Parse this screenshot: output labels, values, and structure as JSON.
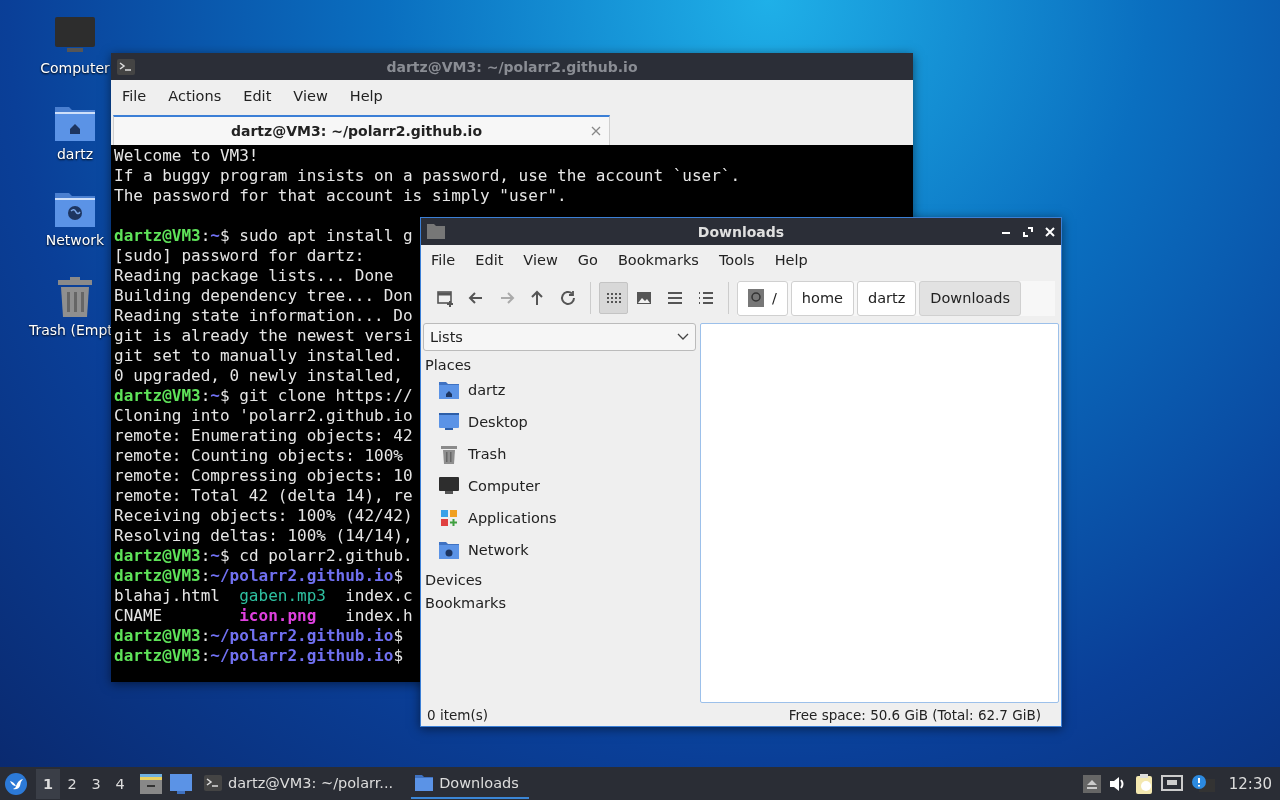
{
  "desktop_icons": [
    {
      "label": "Computer",
      "kind": "computer"
    },
    {
      "label": "dartz",
      "kind": "home"
    },
    {
      "label": "Network",
      "kind": "network"
    },
    {
      "label": "Trash (Empt",
      "kind": "trash"
    }
  ],
  "terminal": {
    "title": "dartz@VM3: ~/polarr2.github.io",
    "menu": [
      "File",
      "Actions",
      "Edit",
      "View",
      "Help"
    ],
    "tab": "dartz@VM3: ~/polarr2.github.io",
    "lines": [
      {
        "kind": "text",
        "segments": [
          {
            "text": "Welcome to VM3!",
            "kind": "plain"
          }
        ]
      },
      {
        "kind": "text",
        "segments": [
          {
            "text": "If a buggy program insists on a password, use the account `user`.",
            "kind": "plain"
          }
        ]
      },
      {
        "kind": "text",
        "segments": [
          {
            "text": "The password for that account is simply \"user\".",
            "kind": "plain"
          }
        ]
      },
      {
        "kind": "blank"
      },
      {
        "kind": "text",
        "segments": [
          {
            "text": "dartz@VM3",
            "kind": "user"
          },
          {
            "text": ":",
            "kind": "plain"
          },
          {
            "text": "~",
            "kind": "path"
          },
          {
            "text": "$ sudo apt install g",
            "kind": "plain"
          }
        ]
      },
      {
        "kind": "text",
        "segments": [
          {
            "text": "[sudo] password for dartz:",
            "kind": "plain"
          }
        ]
      },
      {
        "kind": "text",
        "segments": [
          {
            "text": "Reading package lists... Done",
            "kind": "plain"
          }
        ]
      },
      {
        "kind": "text",
        "segments": [
          {
            "text": "Building dependency tree... Don",
            "kind": "plain"
          }
        ]
      },
      {
        "kind": "text",
        "segments": [
          {
            "text": "Reading state information... Do",
            "kind": "plain"
          }
        ]
      },
      {
        "kind": "text",
        "segments": [
          {
            "text": "git is already the newest versi",
            "kind": "plain"
          }
        ]
      },
      {
        "kind": "text",
        "segments": [
          {
            "text": "git set to manually installed.",
            "kind": "plain"
          }
        ]
      },
      {
        "kind": "text",
        "segments": [
          {
            "text": "0 upgraded, 0 newly installed,",
            "kind": "plain"
          }
        ]
      },
      {
        "kind": "text",
        "segments": [
          {
            "text": "dartz@VM3",
            "kind": "user"
          },
          {
            "text": ":",
            "kind": "plain"
          },
          {
            "text": "~",
            "kind": "path"
          },
          {
            "text": "$ git clone https://",
            "kind": "plain"
          }
        ]
      },
      {
        "kind": "text",
        "segments": [
          {
            "text": "Cloning into 'polarr2.github.io",
            "kind": "plain"
          }
        ]
      },
      {
        "kind": "text",
        "segments": [
          {
            "text": "remote: Enumerating objects: 42",
            "kind": "plain"
          }
        ]
      },
      {
        "kind": "text",
        "segments": [
          {
            "text": "remote: Counting objects: 100%",
            "kind": "plain"
          }
        ]
      },
      {
        "kind": "text",
        "segments": [
          {
            "text": "remote: Compressing objects: 10",
            "kind": "plain"
          }
        ]
      },
      {
        "kind": "text",
        "segments": [
          {
            "text": "remote: Total 42 (delta 14), re",
            "kind": "plain"
          }
        ]
      },
      {
        "kind": "text",
        "segments": [
          {
            "text": "Receiving objects: 100% (42/42)",
            "kind": "plain"
          }
        ]
      },
      {
        "kind": "text",
        "segments": [
          {
            "text": "Resolving deltas: 100% (14/14),",
            "kind": "plain"
          }
        ]
      },
      {
        "kind": "text",
        "segments": [
          {
            "text": "dartz@VM3",
            "kind": "user"
          },
          {
            "text": ":",
            "kind": "plain"
          },
          {
            "text": "~",
            "kind": "path"
          },
          {
            "text": "$ cd polarr2.github.",
            "kind": "plain"
          }
        ]
      },
      {
        "kind": "text",
        "segments": [
          {
            "text": "dartz@VM3",
            "kind": "user"
          },
          {
            "text": ":",
            "kind": "plain"
          },
          {
            "text": "~/polarr2.github.io",
            "kind": "path"
          },
          {
            "text": "$",
            "kind": "plain"
          }
        ]
      },
      {
        "kind": "text",
        "segments": [
          {
            "text": "blahaj.html  ",
            "kind": "plain"
          },
          {
            "text": "gaben.mp3",
            "kind": "audio"
          },
          {
            "text": "  index.c",
            "kind": "plain"
          }
        ]
      },
      {
        "kind": "text",
        "segments": [
          {
            "text": "CNAME        ",
            "kind": "plain"
          },
          {
            "text": "icon.png",
            "kind": "image"
          },
          {
            "text": "   index.h",
            "kind": "plain"
          }
        ]
      },
      {
        "kind": "text",
        "segments": [
          {
            "text": "dartz@VM3",
            "kind": "user"
          },
          {
            "text": ":",
            "kind": "plain"
          },
          {
            "text": "~/polarr2.github.io",
            "kind": "path"
          },
          {
            "text": "$",
            "kind": "plain"
          }
        ]
      },
      {
        "kind": "text",
        "segments": [
          {
            "text": "dartz@VM3",
            "kind": "user"
          },
          {
            "text": ":",
            "kind": "plain"
          },
          {
            "text": "~/polarr2.github.io",
            "kind": "path"
          },
          {
            "text": "$",
            "kind": "plain"
          }
        ]
      }
    ]
  },
  "file_manager": {
    "title": "Downloads",
    "menu": [
      "File",
      "Edit",
      "View",
      "Go",
      "Bookmarks",
      "Tools",
      "Help"
    ],
    "nav_buttons": [
      {
        "kind": "new-tab",
        "disabled": false
      },
      {
        "kind": "back",
        "disabled": false
      },
      {
        "kind": "forward",
        "disabled": true
      },
      {
        "kind": "up",
        "disabled": false
      },
      {
        "kind": "reload",
        "disabled": false
      }
    ],
    "view_modes": [
      {
        "kind": "icons",
        "selected": true
      },
      {
        "kind": "thumbnails",
        "selected": false
      },
      {
        "kind": "compact",
        "selected": false
      },
      {
        "kind": "detailed",
        "selected": false
      }
    ],
    "path": [
      {
        "label": "/",
        "kind": "root",
        "selected": false
      },
      {
        "label": "home",
        "kind": "folder",
        "selected": false
      },
      {
        "label": "dartz",
        "kind": "folder",
        "selected": false
      },
      {
        "label": "Downloads",
        "kind": "folder",
        "selected": true
      }
    ],
    "side_pane": {
      "mode": "Lists",
      "sections": [
        {
          "title": "Places",
          "items": [
            {
              "label": "dartz",
              "kind": "home"
            },
            {
              "label": "Desktop",
              "kind": "desktop"
            },
            {
              "label": "Trash",
              "kind": "trash"
            },
            {
              "label": "Computer",
              "kind": "computer"
            },
            {
              "label": "Applications",
              "kind": "applications"
            },
            {
              "label": "Network",
              "kind": "network"
            }
          ]
        },
        {
          "title": "Devices"
        },
        {
          "title": "Bookmarks"
        }
      ]
    },
    "status_bar": {
      "items": "0 item(s)",
      "free_space": "Free space: 50.6 GiB (Total: 62.7 GiB)"
    }
  },
  "taskbar": {
    "workspaces": [
      {
        "label": "1",
        "selected": true
      },
      {
        "label": "2",
        "selected": false
      },
      {
        "label": "3",
        "selected": false
      },
      {
        "label": "4",
        "selected": false
      }
    ],
    "launchers": [
      {
        "kind": "file-manager"
      },
      {
        "kind": "desktop"
      }
    ],
    "tasks": [
      {
        "label": "dartz@VM3: ~/polarr...",
        "kind": "terminal",
        "selected": false
      },
      {
        "label": "Downloads",
        "kind": "folder",
        "selected": true
      }
    ],
    "tray": [
      {
        "kind": "eject"
      },
      {
        "kind": "volume"
      },
      {
        "kind": "clipboard"
      },
      {
        "kind": "network"
      },
      {
        "kind": "alert"
      }
    ],
    "clock": "12:30"
  }
}
